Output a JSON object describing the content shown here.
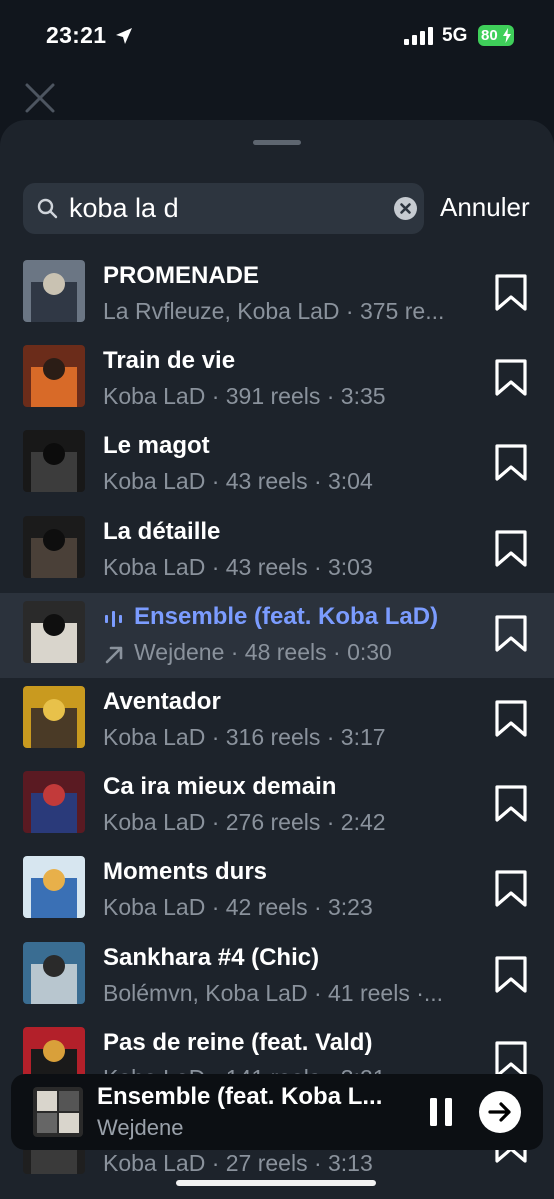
{
  "status_bar": {
    "time": "23:21",
    "network": "5G",
    "battery": "80"
  },
  "search": {
    "value": "koba la d",
    "placeholder": "",
    "cancel_label": "Annuler"
  },
  "results": [
    {
      "title": "PROMENADE",
      "subtitle": "La Rvfleuze, Koba LaD · 375 re...",
      "cover_colors": [
        "#6b7684",
        "#303845",
        "#c9c2b2"
      ]
    },
    {
      "title": "Train de vie",
      "subtitle": "Koba LaD · 391 reels · 3:35",
      "cover_colors": [
        "#6b2c1a",
        "#d86a28",
        "#2b1d16"
      ]
    },
    {
      "title": "Le magot",
      "subtitle": "Koba LaD · 43 reels · 3:04",
      "cover_colors": [
        "#181818",
        "#3c3c3c",
        "#0c0c0c"
      ]
    },
    {
      "title": "La détaille",
      "subtitle": "Koba LaD · 43 reels · 3:03",
      "cover_colors": [
        "#1b1b1b",
        "#4a4038",
        "#0e0e0e"
      ]
    },
    {
      "title": "Ensemble (feat. Koba LaD)",
      "subtitle": "Wejdene · 48 reels · 0:30",
      "cover_colors": [
        "#2a2a2a",
        "#d9d5cc",
        "#0f0f0f"
      ],
      "active": true
    },
    {
      "title": "Aventador",
      "subtitle": "Koba LaD · 316 reels · 3:17",
      "cover_colors": [
        "#c99a1f",
        "#4a3a26",
        "#e8c14a"
      ]
    },
    {
      "title": "Ca ira mieux demain",
      "subtitle": "Koba LaD · 276 reels · 2:42",
      "cover_colors": [
        "#5a1a22",
        "#2a3a7a",
        "#c23a3a"
      ]
    },
    {
      "title": "Moments durs",
      "subtitle": "Koba LaD · 42 reels · 3:23",
      "cover_colors": [
        "#d7e6f0",
        "#3a70b5",
        "#e8b04a"
      ]
    },
    {
      "title": "Sankhara #4 (Chic)",
      "subtitle": "Bolémvn, Koba LaD · 41 reels ·...",
      "cover_colors": [
        "#3a6d92",
        "#b8c6cf",
        "#2a2a2a"
      ]
    },
    {
      "title": "Pas de reine (feat. Vald)",
      "subtitle": "Koba LaD · 141 reels · 3:21",
      "cover_colors": [
        "#b3202a",
        "#1a1a1a",
        "#d9a03a"
      ]
    },
    {
      "title": "",
      "subtitle": "Koba LaD · 27 reels · 3:13",
      "cover_colors": [
        "#1f1f1f",
        "#3a3a3a",
        "#111111"
      ]
    }
  ],
  "now_playing": {
    "title": "Ensemble (feat. Koba L...",
    "artist": "Wejdene"
  },
  "colors": {
    "accent": "#7b9cff",
    "battery": "#3fcf5a",
    "sheet": "#1d232b"
  },
  "icons": [
    "location-arrow-icon",
    "signal-icon",
    "close-icon",
    "search-icon",
    "clear-icon",
    "bookmark-icon",
    "playing-bars-icon",
    "trend-arrow-icon",
    "pause-icon",
    "next-arrow-icon"
  ]
}
